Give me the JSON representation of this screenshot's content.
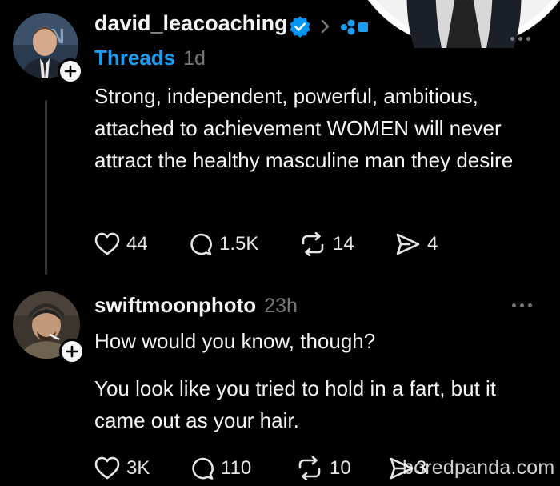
{
  "post": {
    "username": "david_leacoaching",
    "source": "Threads",
    "time": "1d",
    "text": "Strong, independent, powerful, ambitious, attached to achievement WOMEN will never attract the healthy masculine man they desire",
    "likes": "44",
    "replies": "1.5K",
    "reposts": "14",
    "shares": "4",
    "verified": true
  },
  "reply": {
    "username": "swiftmoonphoto",
    "time": "23h",
    "text_line1": "How would you know, though?",
    "text_line2": "You look like you tried to hold in a fart, but it came out as your hair.",
    "likes": "3K",
    "replies": "110",
    "reposts": "10",
    "shares": "3"
  },
  "watermark": "boredpanda.com",
  "colors": {
    "background": "#000000",
    "text": "#f3f5f7",
    "threads_link": "#1d9bf0",
    "verified_badge": "#0095f6",
    "muted": "#777777"
  }
}
